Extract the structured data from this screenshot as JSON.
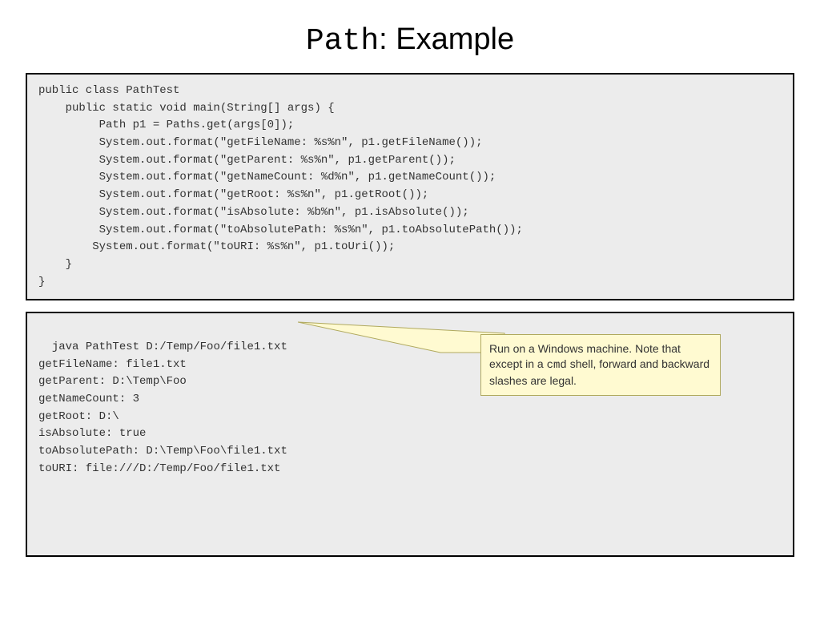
{
  "title": {
    "mono": "Path",
    "rest": ": Example"
  },
  "code": "public class PathTest\n    public static void main(String[] args) {\n         Path p1 = Paths.get(args[0]);\n         System.out.format(\"getFileName: %s%n\", p1.getFileName());\n         System.out.format(\"getParent: %s%n\", p1.getParent());\n         System.out.format(\"getNameCount: %d%n\", p1.getNameCount());\n         System.out.format(\"getRoot: %s%n\", p1.getRoot());\n         System.out.format(\"isAbsolute: %b%n\", p1.isAbsolute());\n         System.out.format(\"toAbsolutePath: %s%n\", p1.toAbsolutePath());\n        System.out.format(\"toURI: %s%n\", p1.toUri());\n    }\n}",
  "output": "java PathTest D:/Temp/Foo/file1.txt\ngetFileName: file1.txt\ngetParent: D:\\Temp\\Foo\ngetNameCount: 3\ngetRoot: D:\\\nisAbsolute: true\ntoAbsolutePath: D:\\Temp\\Foo\\file1.txt\ntoURI: file:///D:/Temp/Foo/file1.txt",
  "callout": {
    "part1": "Run on a Windows machine. Note that except in a ",
    "cmd": "cmd",
    "part2": " shell, forward and backward slashes are legal."
  }
}
